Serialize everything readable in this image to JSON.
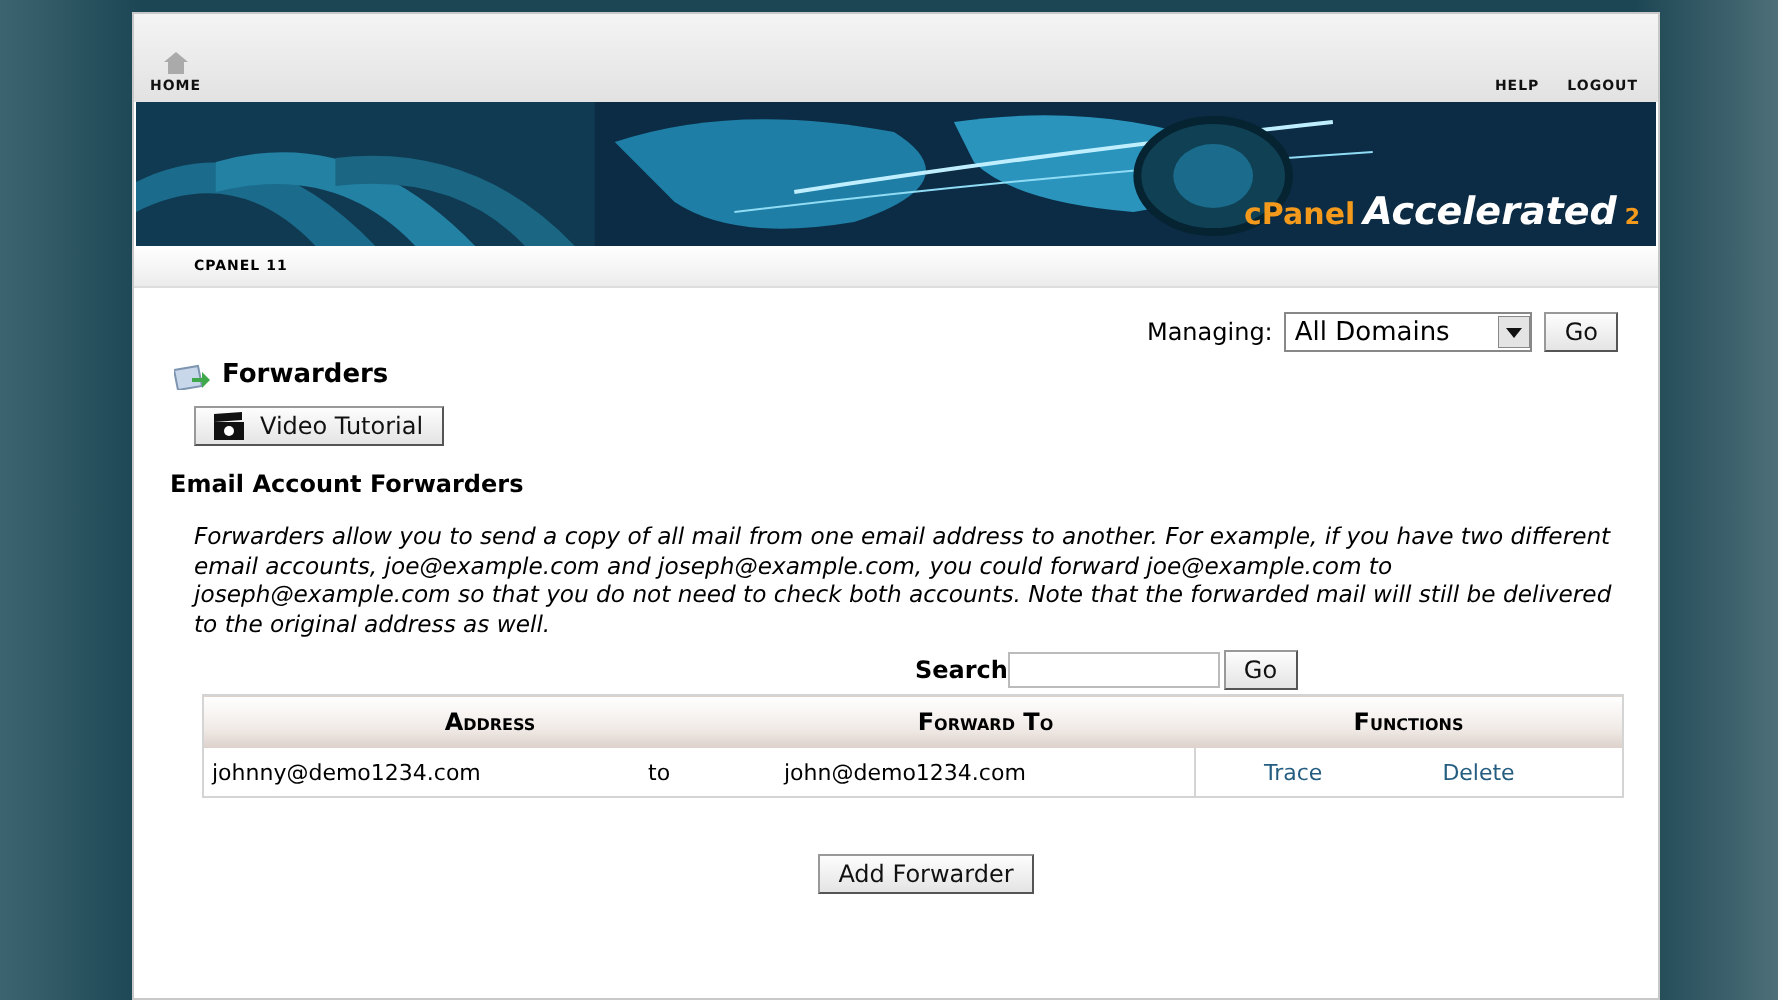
{
  "top_nav": {
    "home": "HOME",
    "help": "HELP",
    "logout": "LOGOUT"
  },
  "banner": {
    "kind": "picture",
    "logo_c": "cPanel",
    "logo_accelerated": "Accelerated",
    "logo_version": "2"
  },
  "breadcrumb": "CPANEL 11",
  "managing": {
    "label": "Managing:",
    "value": "All Domains",
    "button": "Go"
  },
  "page_title": "Forwarders",
  "video_button": "Video Tutorial",
  "section_title": "Email Account Forwarders",
  "description": "Forwarders allow you to send a copy of all mail from one email address to another. For example, if you have two different email accounts, joe@example.com and joseph@example.com, you could forward joe@example.com to joseph@example.com so that you do not need to check both accounts. Note that the forwarded mail will still be delivered to the original address as well.",
  "search": {
    "label": "Search",
    "button": "Go"
  },
  "table": {
    "columns": [
      "Address",
      "Forward To",
      "Functions"
    ],
    "rows": [
      {
        "address": "johnny@demo1234.com",
        "separator": "to",
        "forward_to": "john@demo1234.com",
        "actions": [
          "Trace",
          "Delete"
        ]
      }
    ]
  },
  "add_button": "Add Forwarder"
}
